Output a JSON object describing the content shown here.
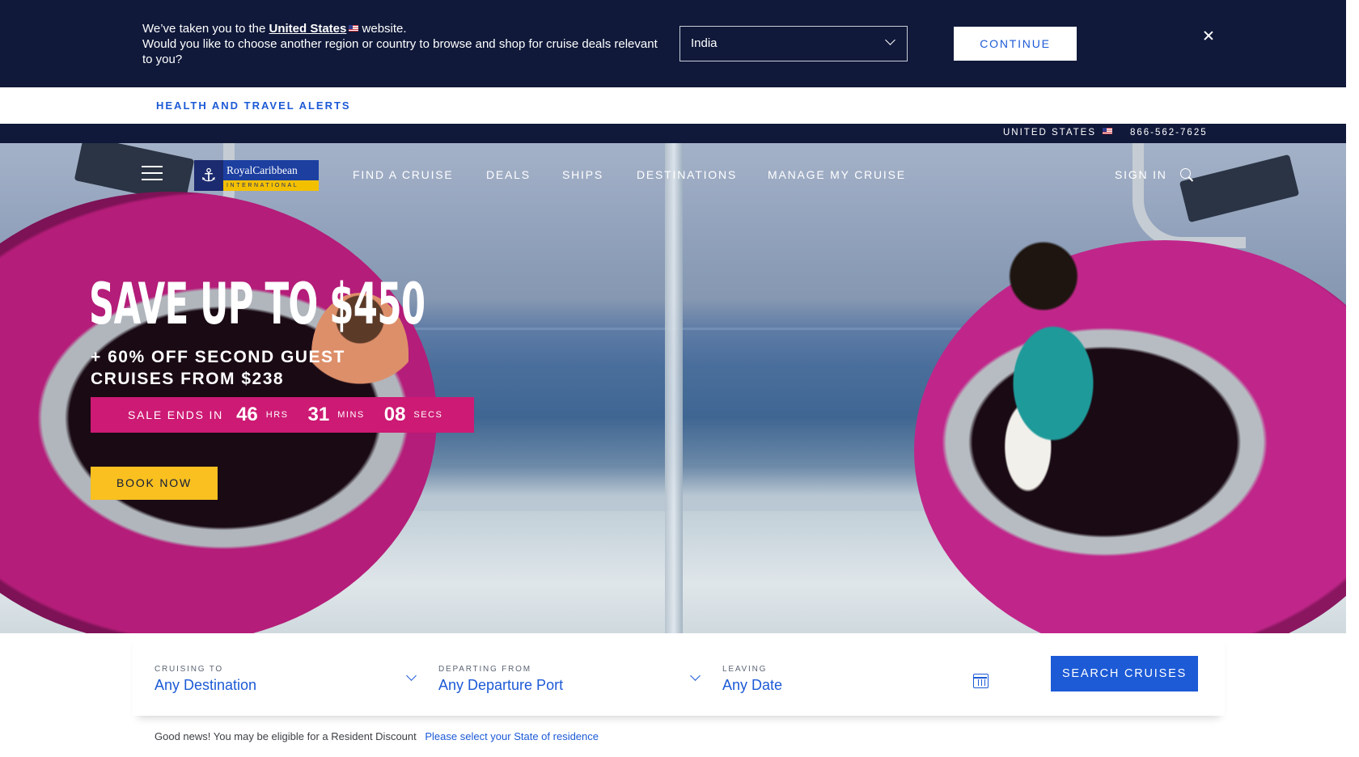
{
  "colors": {
    "navy": "#10193a",
    "accent_blue": "#1c5ad6",
    "promo_pink": "#cd1a74",
    "cta_yellow": "#f9c01f"
  },
  "region_banner": {
    "line1_prefix": "We’ve taken you to the",
    "line1_link": "United States",
    "line1_suffix": "website.",
    "line2": "Would you like to choose another region or country to browse and shop for cruise deals relevant to you?",
    "selected_region": "India",
    "continue_label": "CONTINUE",
    "close_icon": "close-icon"
  },
  "alerts": {
    "label": "HEALTH AND TRAVEL ALERTS"
  },
  "utility": {
    "country": "UNITED STATES",
    "phone": "866-562-7625"
  },
  "nav": {
    "logo_name": "RoyalCaribbean",
    "logo_sub": "INTERNATIONAL",
    "items": [
      "FIND A CRUISE",
      "DEALS",
      "SHIPS",
      "DESTINATIONS",
      "MANAGE MY CRUISE"
    ],
    "sign_in": "SIGN IN"
  },
  "promo": {
    "headline": "SAVE UP TO $450",
    "sub1": "+ 60% OFF SECOND GUEST",
    "sub2": "CRUISES FROM $238",
    "countdown": {
      "label": "SALE ENDS IN",
      "hours": "46",
      "hours_unit": "HRS",
      "minutes": "31",
      "minutes_unit": "MINS",
      "seconds": "08",
      "seconds_unit": "SECS"
    },
    "cta": "BOOK NOW"
  },
  "search": {
    "destination": {
      "label": "CRUISING TO",
      "value": "Any Destination"
    },
    "departure": {
      "label": "DEPARTING FROM",
      "value": "Any Departure Port"
    },
    "date": {
      "label": "LEAVING",
      "value": "Any Date"
    },
    "button": "SEARCH CRUISES"
  },
  "resident": {
    "text": "Good news! You may be eligible for a Resident Discount",
    "link": "Please select your State of residence"
  }
}
